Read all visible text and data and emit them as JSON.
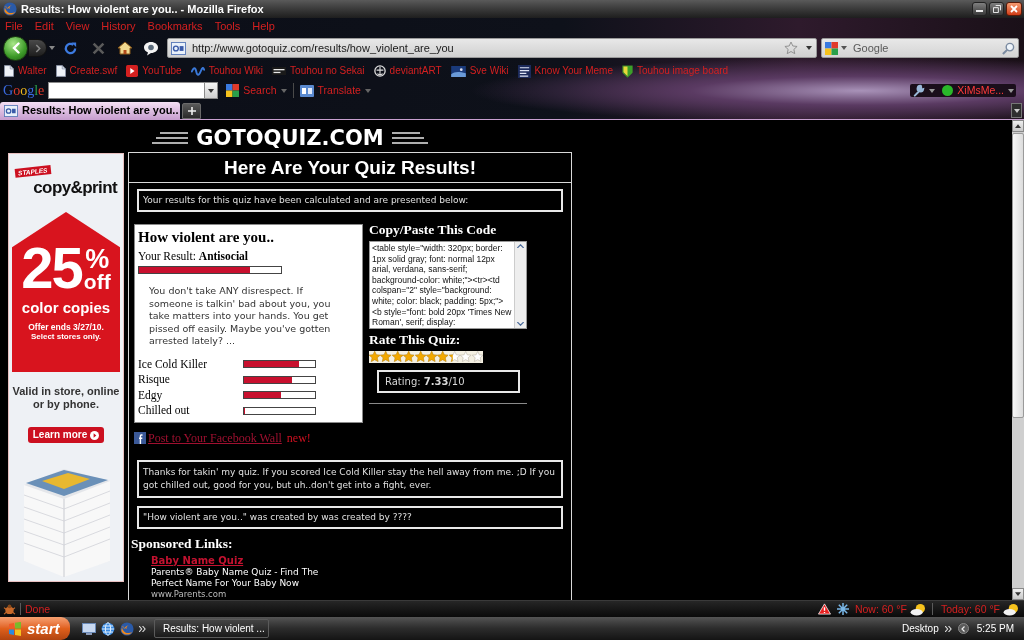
{
  "window": {
    "title": "Results: How violent are you.. - Mozilla Firefox"
  },
  "menu": [
    "File",
    "Edit",
    "View",
    "History",
    "Bookmarks",
    "Tools",
    "Help"
  ],
  "address_bar": {
    "url": "http://www.gotoquiz.com/results/how_violent_are_you"
  },
  "search_bar": {
    "placeholder": "Google"
  },
  "bookmarks": [
    {
      "label": "Walter",
      "kind": "page"
    },
    {
      "label": "Create.swf",
      "kind": "page"
    },
    {
      "label": "YouTube",
      "kind": "video"
    },
    {
      "label": "Touhou Wiki",
      "kind": "wave"
    },
    {
      "label": "Touhou no Sekai",
      "kind": "label"
    },
    {
      "label": "deviantART",
      "kind": "emblem"
    },
    {
      "label": "Sve Wiki",
      "kind": "landscape"
    },
    {
      "label": "Know Your Meme",
      "kind": "card"
    },
    {
      "label": "Touhou image board",
      "kind": "shield"
    }
  ],
  "google_toolbar": {
    "logo": "Google",
    "buttons": [
      {
        "label": "Search",
        "kind": "search"
      },
      {
        "label": "Translate",
        "kind": "translate"
      }
    ],
    "account": "XiMsMe..."
  },
  "tabs": [
    {
      "label": "Results: How violent are you..",
      "selected": true
    }
  ],
  "page": {
    "logo": "GOTOQUIZ.COM",
    "ad": {
      "brand": "STAPLES",
      "headline": "copy&print",
      "amount": "25",
      "unit": "%",
      "suffix": "off",
      "product": "color copies",
      "offer": "Offer ends 3/27/10.",
      "fine_print": "Select stores only.",
      "availability": "Valid in store, online or by phone.",
      "button": "Learn more"
    },
    "header": "Here Are Your Quiz Results!",
    "intro": "Your results for this quiz have been calculated and are presented below:",
    "result_card": {
      "title": "How violent are you..",
      "result": "Your Result: **Antisocial**",
      "level": 0.78,
      "description": "You don't take ANY disrespect. If someone is talkin' bad about you, you take matters into your hands. You get pissed off easily. Maybe you've gotten arrested lately? ...",
      "scores": [
        {
          "name": "Ice Cold Killer",
          "level": 0.77
        },
        {
          "name": "Risque",
          "level": 0.67
        },
        {
          "name": "Edgy",
          "level": 0.52
        },
        {
          "name": "Chilled out",
          "level": 0
        }
      ]
    },
    "code": {
      "heading": "Copy/Paste This Code",
      "text": "<table style=\"width: 320px; border: 1px solid gray; font: normal 12px arial, verdana, sans-serif; background-color: white;\"><tr><td colspan=\"2\" style=\"background: white; color: black; padding: 5px;\"><b style=\"font: bold 20px 'Times New Roman', serif; display:"
    },
    "rating": {
      "heading": "Rate This Quiz:",
      "stars": 7.33,
      "summary": "Rating: **7.33**/10"
    },
    "facebook": {
      "link": "Post to Your Facebook Wall",
      "badge": "new!"
    },
    "note": "Thanks for takin' my quiz. If you scored Ice Cold Killer stay the hell away from me. ;D If you got chilled out, good for you, but uh..don't get into a fight, ever.",
    "credit": "\"How violent are you..\" was created by was created by ????",
    "sponsored": {
      "heading": "Sponsored Links:",
      "links": [
        {
          "title": "Baby Name Quiz",
          "description": "Parents® Baby Name Quiz - Find The Perfect Name For Your Baby Now",
          "url": "www.Parents.com"
        }
      ]
    }
  },
  "status_bar": {
    "text": "Done",
    "weather": [
      "Now: 60 °F",
      "Today: 60 °F"
    ]
  },
  "taskbar": {
    "start": "start",
    "tasks": [
      "Results: How violent ..."
    ],
    "toolbar": "Desktop",
    "clock": "5:25 PM"
  }
}
